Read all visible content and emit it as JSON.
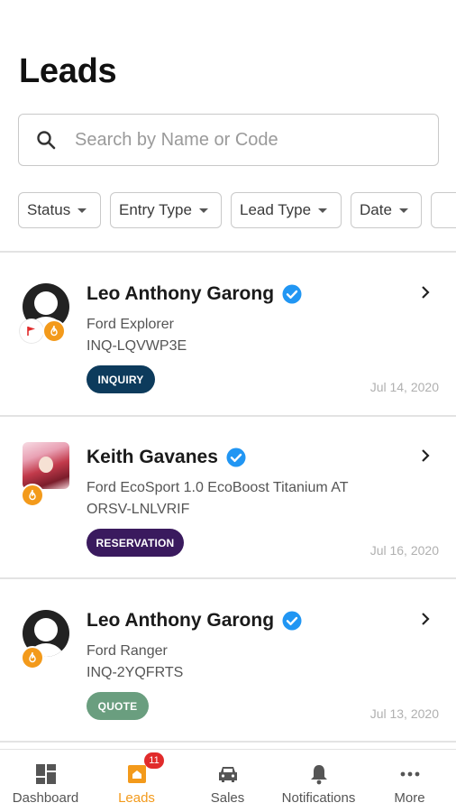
{
  "header": {
    "title": "Leads"
  },
  "search": {
    "placeholder": "Search by Name or Code",
    "icon": "search-icon"
  },
  "filters": [
    {
      "label": "Status"
    },
    {
      "label": "Entry Type"
    },
    {
      "label": "Lead Type"
    },
    {
      "label": "Date"
    }
  ],
  "leads": [
    {
      "name": "Leo Anthony Garong",
      "model": "Ford Explorer",
      "code": "INQ-LQVWP3E",
      "status": "INQUIRY",
      "status_color": "#0d3b5c",
      "date": "Jul 14, 2020",
      "flagged": true,
      "hot": true,
      "verified": true
    },
    {
      "name": "Keith Gavanes",
      "model": "Ford EcoSport 1.0 EcoBoost Titanium AT",
      "code": "ORSV-LNLVRIF",
      "status": "RESERVATION",
      "status_color": "#3a1a5e",
      "date": "Jul 16, 2020",
      "flagged": false,
      "hot": true,
      "verified": true
    },
    {
      "name": "Leo Anthony Garong",
      "model": "Ford Ranger",
      "code": "INQ-2YQFRTS",
      "status": "QUOTE",
      "status_color": "#6a9e7f",
      "date": "Jul 13, 2020",
      "flagged": false,
      "hot": true,
      "verified": true
    }
  ],
  "bottom_nav": [
    {
      "label": "Dashboard",
      "icon": "dashboard-icon",
      "active": false
    },
    {
      "label": "Leads",
      "icon": "leads-icon",
      "active": true,
      "badge": "11"
    },
    {
      "label": "Sales",
      "icon": "car-icon",
      "active": false
    },
    {
      "label": "Notifications",
      "icon": "bell-icon",
      "active": false
    },
    {
      "label": "More",
      "icon": "more-icon",
      "active": false
    }
  ],
  "colors": {
    "accent": "#f39a1b",
    "verified": "#2196f3",
    "badge": "#e12b2b"
  }
}
